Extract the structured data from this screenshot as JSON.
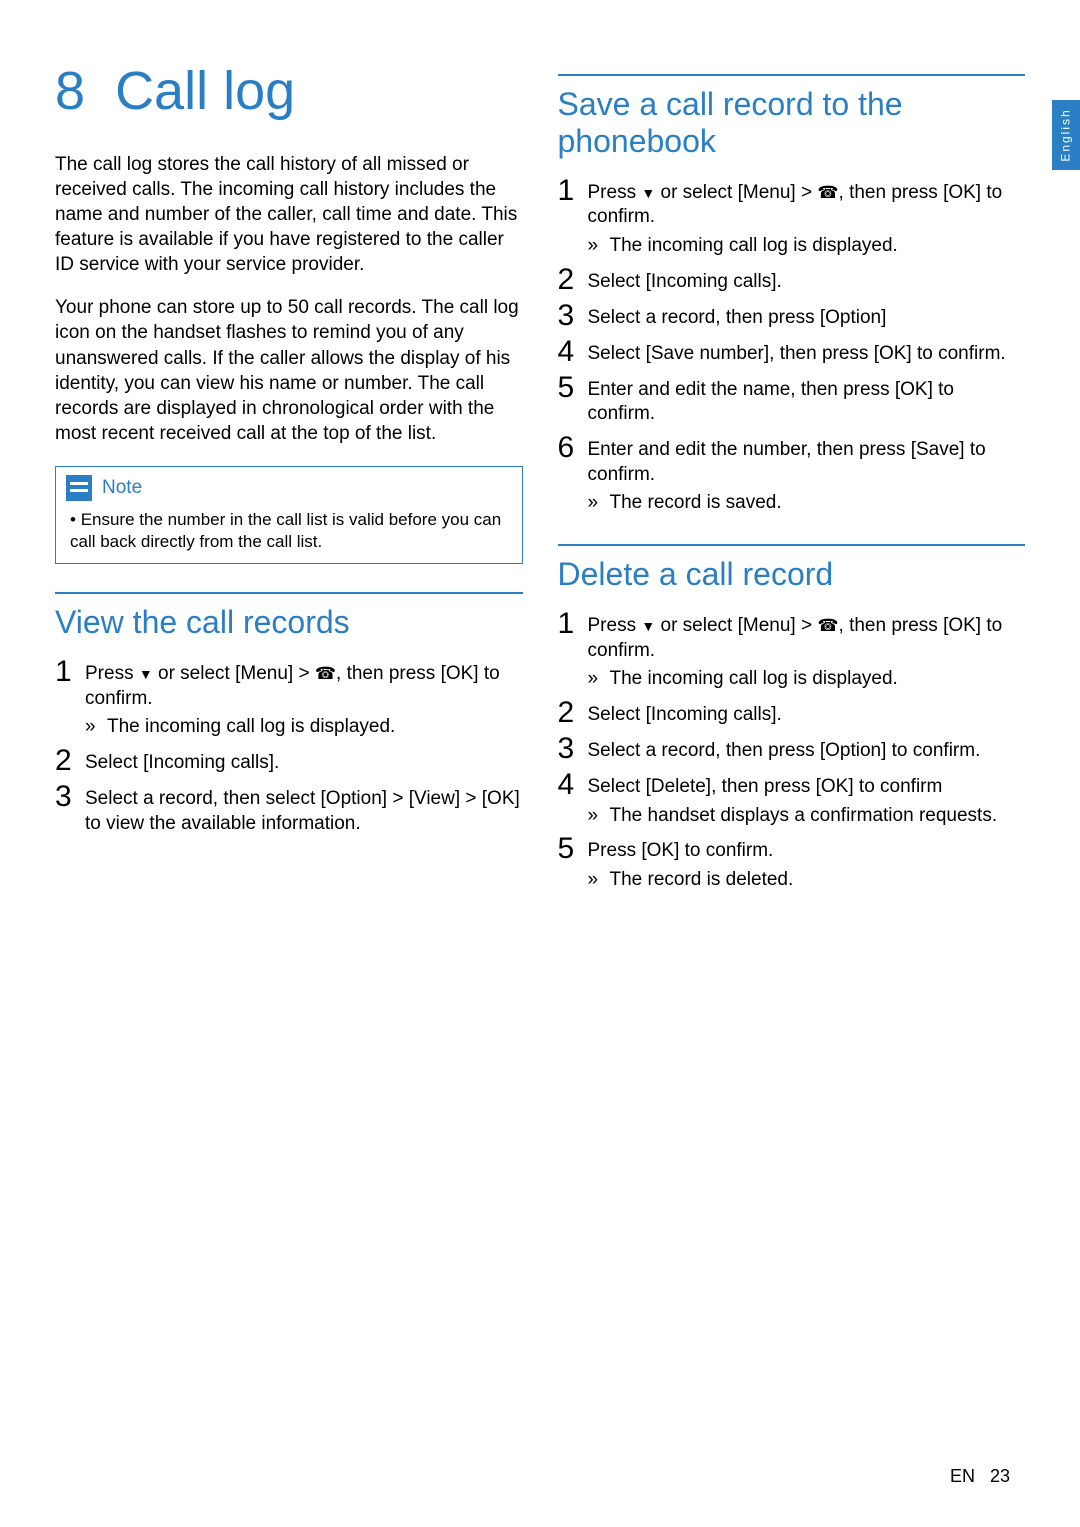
{
  "lang_tab": "English",
  "chapter_number": "8",
  "chapter_title": "Call log",
  "intro_p1": "The call log stores the call history of all missed or received calls. The incoming call history includes the name and number of the caller, call time and date. This feature is available if you have registered to the caller ID service with your service provider.",
  "intro_p2": "Your phone can store up to 50 call records. The call log icon on the handset flashes to remind you of any unanswered calls. If the caller allows the display of his identity, you can view his name or number. The call records are displayed in chronological order with the most recent received call at the top of the list.",
  "note_label": "Note",
  "note_text": "Ensure the number in the call list is valid before you can call back directly from the call list.",
  "section_view": {
    "title": "View the call records",
    "s1a": "Press ",
    "s1b": " or select [Menu] > ",
    "s1c": ", then press [OK] to confirm.",
    "s1_sub": "The incoming call log is displayed.",
    "s2": "Select [Incoming calls].",
    "s3": "Select a record, then select [Option] > [View] > [OK] to view the available information."
  },
  "section_save": {
    "title": "Save a call record to the phonebook",
    "s1a": "Press ",
    "s1b": " or select [Menu] > ",
    "s1c": ", then press [OK] to confirm.",
    "s1_sub": "The incoming call log is displayed.",
    "s2": "Select [Incoming calls].",
    "s3": "Select a record, then press [Option]",
    "s4": "Select [Save number], then press [OK] to confirm.",
    "s5": "Enter and edit the name, then press [OK] to confirm.",
    "s6": "Enter and edit the number, then press [Save] to confirm.",
    "s6_sub": "The record is saved."
  },
  "section_delete": {
    "title": "Delete a call record",
    "s1a": "Press ",
    "s1b": " or select [Menu] > ",
    "s1c": ", then press [OK] to confirm.",
    "s1_sub": "The incoming call log is displayed.",
    "s2": "Select [Incoming calls].",
    "s3": "Select a record, then press [Option] to confirm.",
    "s4": "Select [Delete], then press [OK] to confirm",
    "s4_sub": "The handset displays a confirmation requests.",
    "s5": "Press [OK] to confirm.",
    "s5_sub": "The record is deleted."
  },
  "footer_lang": "EN",
  "footer_page": "23",
  "icons": {
    "nav_down": "▼",
    "call_log": "☎"
  }
}
